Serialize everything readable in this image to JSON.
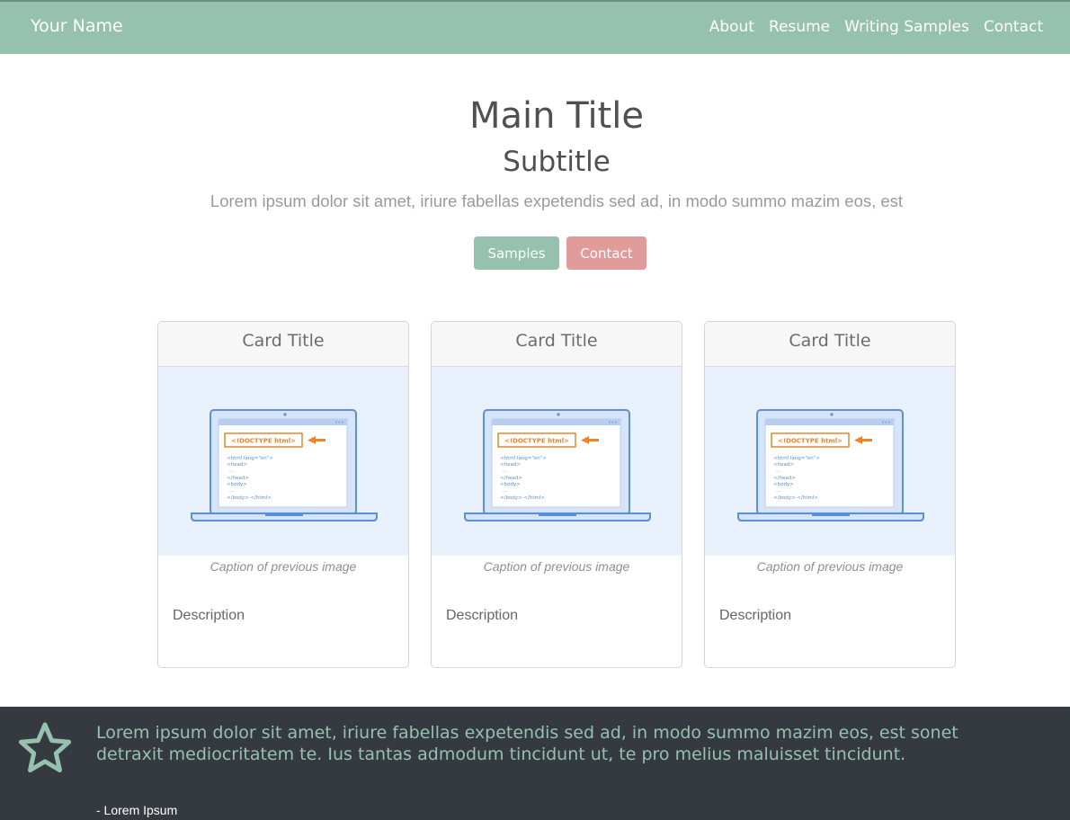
{
  "navbar": {
    "brand": "Your Name",
    "links": [
      "About",
      "Resume",
      "Writing Samples",
      "Contact"
    ],
    "bg_color": "#95c1ae"
  },
  "hero": {
    "title": "Main Title",
    "subtitle": "Subtitle",
    "lead": "Lorem ipsum dolor sit amet, iriure fabellas expetendis sed ad, in modo summo mazim eos, est",
    "buttons": {
      "samples": "Samples",
      "contact": "Contact"
    },
    "samples_color": "#95c1ae",
    "contact_color": "#e09b9b"
  },
  "cards": [
    {
      "title": "Card Title",
      "caption": "Caption of previous image",
      "description": "Description",
      "code": {
        "doctype": "<!DOCTYPE html>",
        "l1": "<html lang=\"en\">",
        "l2": "<head>",
        "l3": "...",
        "l4": "</head>",
        "l5": "<body>",
        "l6": "...",
        "l7": "</body> </html>"
      }
    },
    {
      "title": "Card Title",
      "caption": "Caption of previous image",
      "description": "Description",
      "code": {
        "doctype": "<!DOCTYPE html>",
        "l1": "<html lang=\"en\">",
        "l2": "<head>",
        "l3": "...",
        "l4": "</head>",
        "l5": "<body>",
        "l6": "...",
        "l7": "</body> </html>"
      }
    },
    {
      "title": "Card Title",
      "caption": "Caption of previous image",
      "description": "Description",
      "code": {
        "doctype": "<!DOCTYPE html>",
        "l1": "<html lang=\"en\">",
        "l2": "<head>",
        "l3": "...",
        "l4": "</head>",
        "l5": "<body>",
        "l6": "...",
        "l7": "</body> </html>"
      }
    }
  ],
  "quote": {
    "icon": "star-icon",
    "text": "Lorem ipsum dolor sit amet, iriure fabellas expetendis sed ad, in modo summo mazim eos, est sonet detraxit mediocritatem te. Ius tantas admodum tincidunt ut, te pro melius maluisset tincidunt.",
    "author": "- Lorem Ipsum",
    "band_color": "#343a40"
  }
}
